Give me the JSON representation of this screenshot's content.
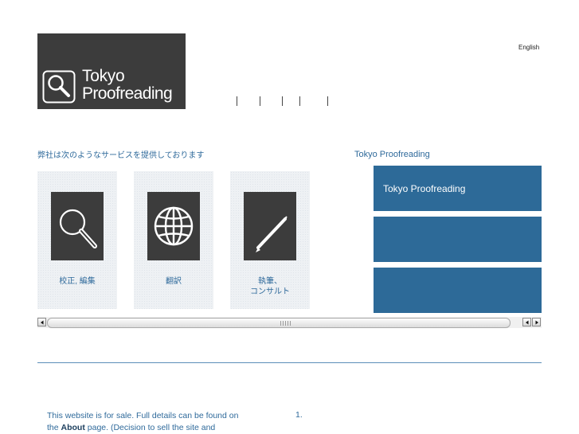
{
  "header": {
    "logo_line1": "Tokyo",
    "logo_line2": "Proofreading",
    "language_link": "English"
  },
  "main": {
    "intro": "弊社は次のようなサービスを提供しております",
    "services": [
      {
        "label": "校正, 編集",
        "icon": "magnifier-icon"
      },
      {
        "label": "翻訳",
        "icon": "globe-icon"
      },
      {
        "label_line1": "執筆、",
        "label_line2": "コンサルト",
        "icon": "pen-icon"
      }
    ]
  },
  "sidebar": {
    "title": "Tokyo Proofreading",
    "panels": [
      {
        "text": "Tokyo Proofreading"
      },
      {
        "text": ""
      },
      {
        "text": ""
      }
    ]
  },
  "footer": {
    "text_part1": "This website is for sale. Full details can be found on the ",
    "about_link": "About",
    "text_part2": " page. (Decision to sell the site and",
    "list_number": "1."
  },
  "colors": {
    "brand_blue": "#2d6a98",
    "logo_bg": "#3c3c3c",
    "text_blue": "#2f6a9b"
  }
}
